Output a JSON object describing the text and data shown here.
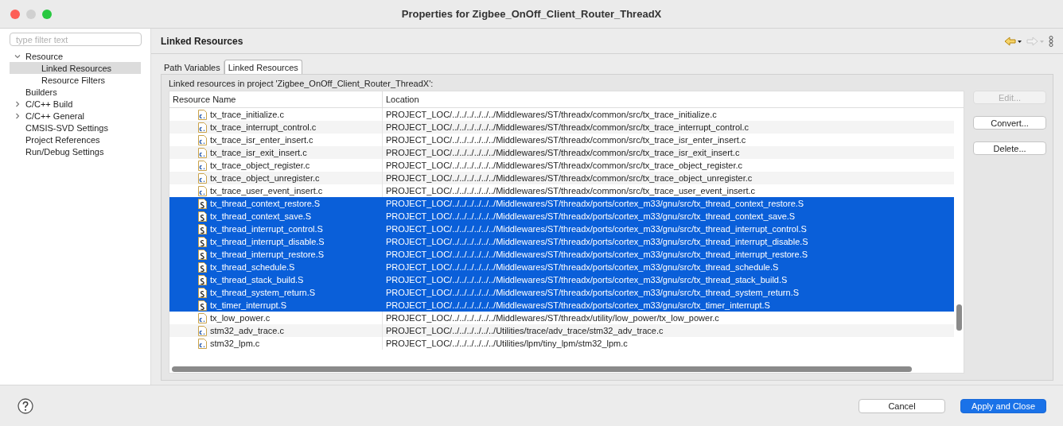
{
  "window": {
    "title": "Properties for Zigbee_OnOff_Client_Router_ThreadX"
  },
  "sidebar": {
    "filter_placeholder": "type filter text",
    "items": [
      {
        "label": "Resource",
        "expanded": true,
        "selected": false,
        "children": [
          {
            "label": "Linked Resources",
            "selected": true
          },
          {
            "label": "Resource Filters",
            "selected": false
          }
        ]
      },
      {
        "label": "Builders",
        "selected": false
      },
      {
        "label": "C/C++ Build",
        "expanded": false,
        "selected": false
      },
      {
        "label": "C/C++ General",
        "expanded": false,
        "selected": false
      },
      {
        "label": "CMSIS-SVD Settings",
        "selected": false
      },
      {
        "label": "Project References",
        "selected": false
      },
      {
        "label": "Run/Debug Settings",
        "selected": false
      }
    ]
  },
  "page": {
    "title": "Linked Resources",
    "tabs": [
      {
        "label": "Path Variables",
        "selected": false
      },
      {
        "label": "Linked Resources",
        "selected": true
      }
    ],
    "description": "Linked resources in project 'Zigbee_OnOff_Client_Router_ThreadX':",
    "table": {
      "columns": [
        "Resource Name",
        "Location"
      ],
      "rows": [
        {
          "kind": "c",
          "name": "tx_trace_initialize.c",
          "location": "PROJECT_LOC/../../../../../../Middlewares/ST/threadx/common/src/tx_trace_initialize.c",
          "selected": false
        },
        {
          "kind": "c",
          "name": "tx_trace_interrupt_control.c",
          "location": "PROJECT_LOC/../../../../../../Middlewares/ST/threadx/common/src/tx_trace_interrupt_control.c",
          "selected": false
        },
        {
          "kind": "c",
          "name": "tx_trace_isr_enter_insert.c",
          "location": "PROJECT_LOC/../../../../../../Middlewares/ST/threadx/common/src/tx_trace_isr_enter_insert.c",
          "selected": false
        },
        {
          "kind": "c",
          "name": "tx_trace_isr_exit_insert.c",
          "location": "PROJECT_LOC/../../../../../../Middlewares/ST/threadx/common/src/tx_trace_isr_exit_insert.c",
          "selected": false
        },
        {
          "kind": "c",
          "name": "tx_trace_object_register.c",
          "location": "PROJECT_LOC/../../../../../../Middlewares/ST/threadx/common/src/tx_trace_object_register.c",
          "selected": false
        },
        {
          "kind": "c",
          "name": "tx_trace_object_unregister.c",
          "location": "PROJECT_LOC/../../../../../../Middlewares/ST/threadx/common/src/tx_trace_object_unregister.c",
          "selected": false
        },
        {
          "kind": "c",
          "name": "tx_trace_user_event_insert.c",
          "location": "PROJECT_LOC/../../../../../../Middlewares/ST/threadx/common/src/tx_trace_user_event_insert.c",
          "selected": false
        },
        {
          "kind": "S",
          "name": "tx_thread_context_restore.S",
          "location": "PROJECT_LOC/../../../../../../Middlewares/ST/threadx/ports/cortex_m33/gnu/src/tx_thread_context_restore.S",
          "selected": true
        },
        {
          "kind": "S",
          "name": "tx_thread_context_save.S",
          "location": "PROJECT_LOC/../../../../../../Middlewares/ST/threadx/ports/cortex_m33/gnu/src/tx_thread_context_save.S",
          "selected": true
        },
        {
          "kind": "S",
          "name": "tx_thread_interrupt_control.S",
          "location": "PROJECT_LOC/../../../../../../Middlewares/ST/threadx/ports/cortex_m33/gnu/src/tx_thread_interrupt_control.S",
          "selected": true
        },
        {
          "kind": "S",
          "name": "tx_thread_interrupt_disable.S",
          "location": "PROJECT_LOC/../../../../../../Middlewares/ST/threadx/ports/cortex_m33/gnu/src/tx_thread_interrupt_disable.S",
          "selected": true
        },
        {
          "kind": "S",
          "name": "tx_thread_interrupt_restore.S",
          "location": "PROJECT_LOC/../../../../../../Middlewares/ST/threadx/ports/cortex_m33/gnu/src/tx_thread_interrupt_restore.S",
          "selected": true
        },
        {
          "kind": "S",
          "name": "tx_thread_schedule.S",
          "location": "PROJECT_LOC/../../../../../../Middlewares/ST/threadx/ports/cortex_m33/gnu/src/tx_thread_schedule.S",
          "selected": true
        },
        {
          "kind": "S",
          "name": "tx_thread_stack_build.S",
          "location": "PROJECT_LOC/../../../../../../Middlewares/ST/threadx/ports/cortex_m33/gnu/src/tx_thread_stack_build.S",
          "selected": true
        },
        {
          "kind": "S",
          "name": "tx_thread_system_return.S",
          "location": "PROJECT_LOC/../../../../../../Middlewares/ST/threadx/ports/cortex_m33/gnu/src/tx_thread_system_return.S",
          "selected": true
        },
        {
          "kind": "S",
          "name": "tx_timer_interrupt.S",
          "location": "PROJECT_LOC/../../../../../../Middlewares/ST/threadx/ports/cortex_m33/gnu/src/tx_timer_interrupt.S",
          "selected": true
        },
        {
          "kind": "c",
          "name": "tx_low_power.c",
          "location": "PROJECT_LOC/../../../../../../Middlewares/ST/threadx/utility/low_power/tx_low_power.c",
          "selected": false
        },
        {
          "kind": "c",
          "name": "stm32_adv_trace.c",
          "location": "PROJECT_LOC/../../../../../../Utilities/trace/adv_trace/stm32_adv_trace.c",
          "selected": false
        },
        {
          "kind": "c",
          "name": "stm32_lpm.c",
          "location": "PROJECT_LOC/../../../../../../Utilities/lpm/tiny_lpm/stm32_lpm.c",
          "selected": false
        }
      ]
    },
    "side_buttons": [
      {
        "label": "Edit...",
        "disabled": true
      },
      {
        "label": "Convert...",
        "disabled": false
      },
      {
        "label": "Delete...",
        "disabled": false
      }
    ]
  },
  "footer": {
    "buttons": [
      {
        "label": "Cancel",
        "kind": "secondary"
      },
      {
        "label": "Apply and Close",
        "kind": "primary"
      }
    ]
  }
}
